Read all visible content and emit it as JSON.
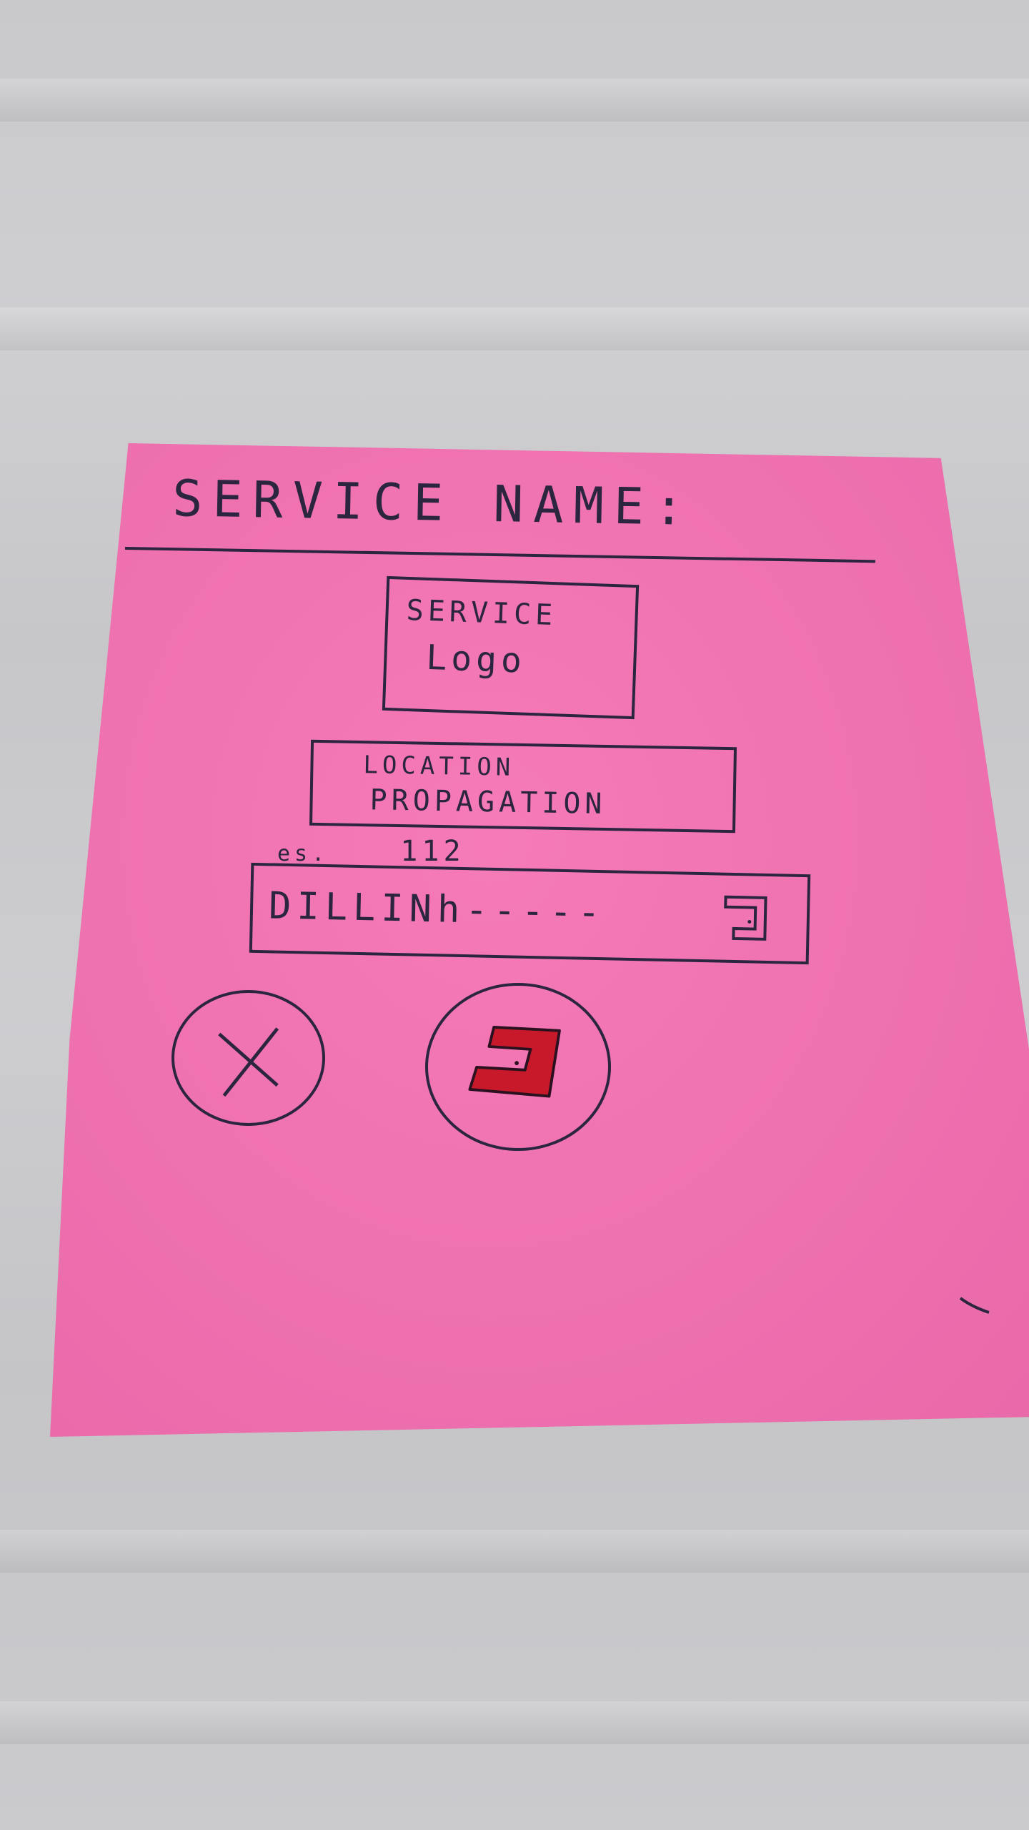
{
  "header": {
    "title": "SERVICE NAME:"
  },
  "logo": {
    "line1": "SERVICE",
    "line2": "Logo"
  },
  "location": {
    "line1": "LOCATION",
    "line2": "PROPAGATION"
  },
  "example": {
    "prefix": "es.",
    "value": "112"
  },
  "search": {
    "value": "DILLINh-----",
    "icon": "return-icon"
  },
  "actions": {
    "cancel_icon": "close-icon",
    "confirm_icon": "return-icon",
    "confirm_color": "#c8192b"
  },
  "colors": {
    "paper": "#f56fb2",
    "ink": "#2b2540",
    "background": "#c9c9cc"
  }
}
